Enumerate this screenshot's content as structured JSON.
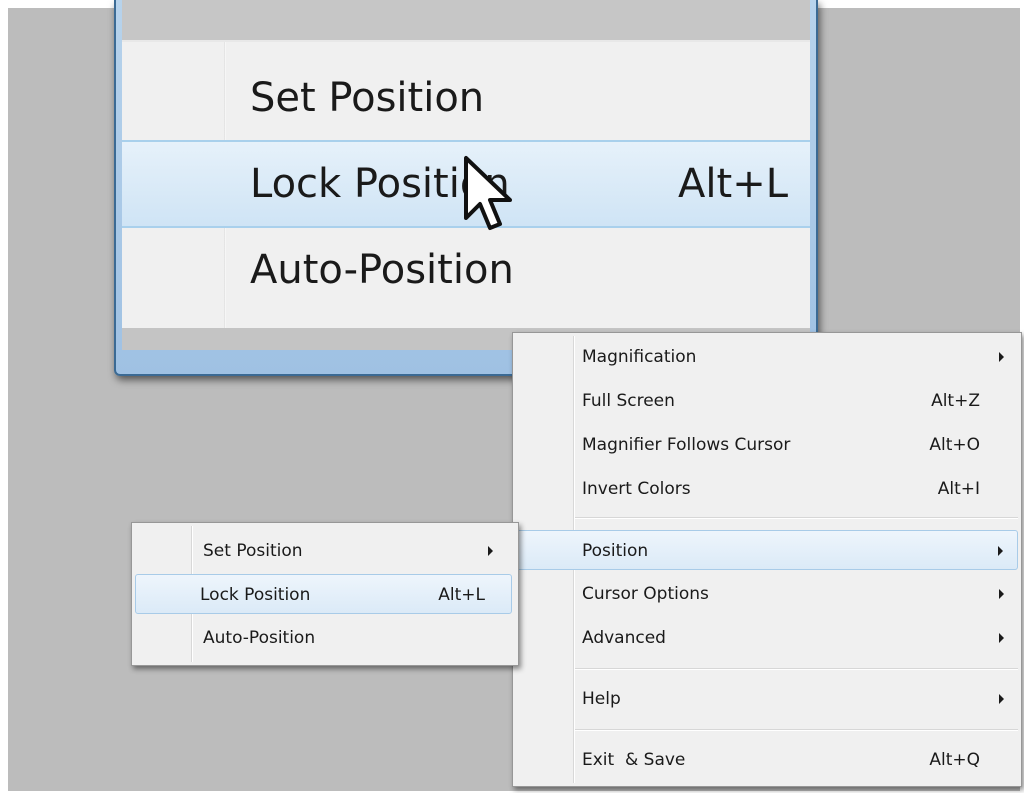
{
  "lens": {
    "items": [
      {
        "label": "Set Position",
        "shortcut": ""
      },
      {
        "label": "Lock Position",
        "shortcut": "Alt+L"
      },
      {
        "label": "Auto-Position",
        "shortcut": ""
      }
    ]
  },
  "main_menu": {
    "magnification": {
      "label": "Magnification",
      "shortcut": ""
    },
    "full_screen": {
      "label": "Full Screen",
      "shortcut": "Alt+Z"
    },
    "follows_cursor": {
      "label": "Magnifier Follows Cursor",
      "shortcut": "Alt+O"
    },
    "invert_colors": {
      "label": "Invert Colors",
      "shortcut": "Alt+I"
    },
    "position": {
      "label": "Position",
      "shortcut": ""
    },
    "cursor_options": {
      "label": "Cursor Options",
      "shortcut": ""
    },
    "advanced": {
      "label": "Advanced",
      "shortcut": ""
    },
    "help": {
      "label": "Help",
      "shortcut": ""
    },
    "exit_save": {
      "label": "Exit  & Save",
      "shortcut": "Alt+Q"
    }
  },
  "sub_menu": {
    "set_position": {
      "label": "Set Position",
      "shortcut": ""
    },
    "lock_position": {
      "label": "Lock Position",
      "shortcut": "Alt+L"
    },
    "auto_position": {
      "label": "Auto-Position",
      "shortcut": ""
    }
  },
  "colors": {
    "highlight_border": "#a8cbe8",
    "lens_frame": "#3b6a94",
    "menu_bg": "#f0f0f0"
  }
}
